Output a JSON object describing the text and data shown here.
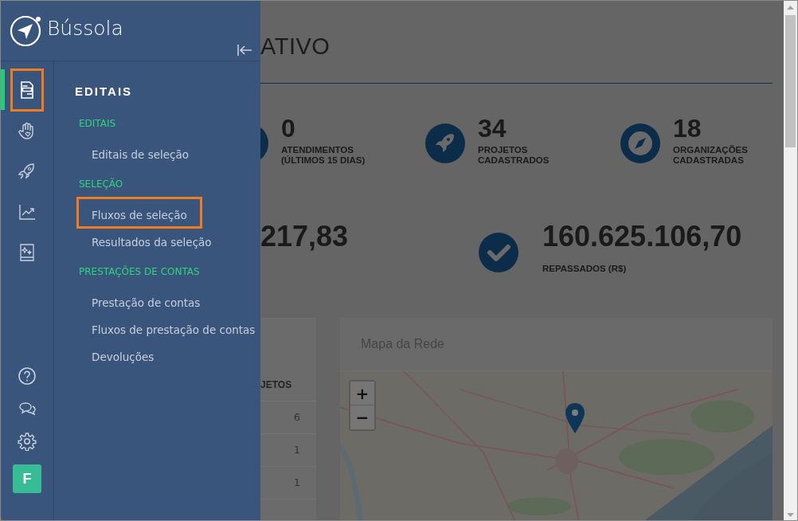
{
  "sidebar": {
    "brand": "Bússola",
    "rail": [
      {
        "selected": true,
        "highlighted": true
      },
      {
        "selected": false,
        "highlighted": false
      },
      {
        "selected": false,
        "highlighted": false
      },
      {
        "selected": false,
        "highlighted": false
      },
      {
        "selected": false,
        "highlighted": false
      }
    ],
    "avatar": "F",
    "menu_title": "EDITAIS",
    "groups": [
      {
        "title": "EDITAIS",
        "items": [
          {
            "label": "Editais de seleção",
            "highlighted": false
          }
        ]
      },
      {
        "title": "SELEÇÃO",
        "items": [
          {
            "label": "Fluxos de seleção",
            "highlighted": true
          },
          {
            "label": "Resultados da seleção",
            "highlighted": false
          }
        ]
      },
      {
        "title": "PRESTAÇÕES DE CONTAS",
        "items": [
          {
            "label": "Prestação de contas",
            "highlighted": false
          },
          {
            "label": "Fluxos de prestação de contas",
            "highlighted": false
          },
          {
            "label": "Devoluções",
            "highlighted": false
          }
        ]
      }
    ]
  },
  "main": {
    "title": "ATIVO",
    "stats": [
      {
        "value": "0",
        "label": "ATENDIMENTOS (ÚLTIMOS 15 DIAS)"
      },
      {
        "value": "34",
        "label": "PROJETOS CADASTRADOS"
      },
      {
        "value": "18",
        "label": "ORGANIZAÇÕES CADASTRADAS"
      }
    ],
    "totals": [
      {
        "value": "217,83"
      },
      {
        "value": "160.625.106,70",
        "label": "REPASSADOS (R$)"
      }
    ],
    "table": {
      "column": "JETOS",
      "rows": [
        "6",
        "1",
        "1"
      ]
    },
    "map": {
      "title": "Mapa da Rede",
      "zoom_in": "+",
      "zoom_out": "−",
      "kind": "picture"
    }
  }
}
